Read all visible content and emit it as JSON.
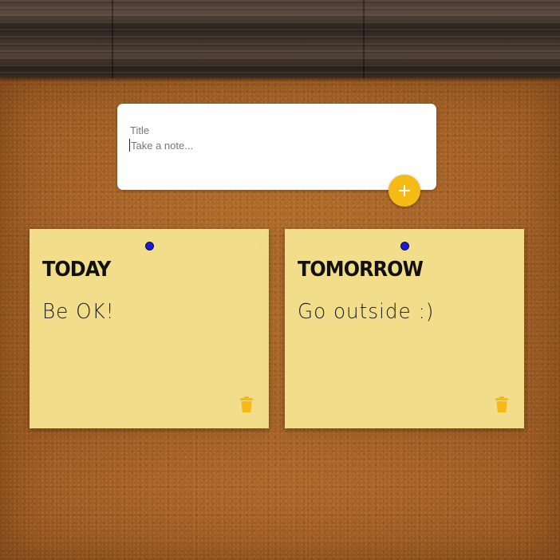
{
  "composer": {
    "title_placeholder": "Title",
    "note_placeholder": "Take a note...",
    "add_icon": "plus-icon"
  },
  "notes": [
    {
      "title": "TODAY",
      "body": "Be OK!",
      "pin_color": "#1b1bd6",
      "delete_icon": "trash-icon"
    },
    {
      "title": "TOMORROW",
      "body": "Go outside :)",
      "pin_color": "#1b1bd6",
      "delete_icon": "trash-icon"
    }
  ],
  "colors": {
    "accent": "#f5ba13",
    "note_background": "#f2de8a",
    "cork": "#a8662a",
    "wood": "#3e322a"
  }
}
